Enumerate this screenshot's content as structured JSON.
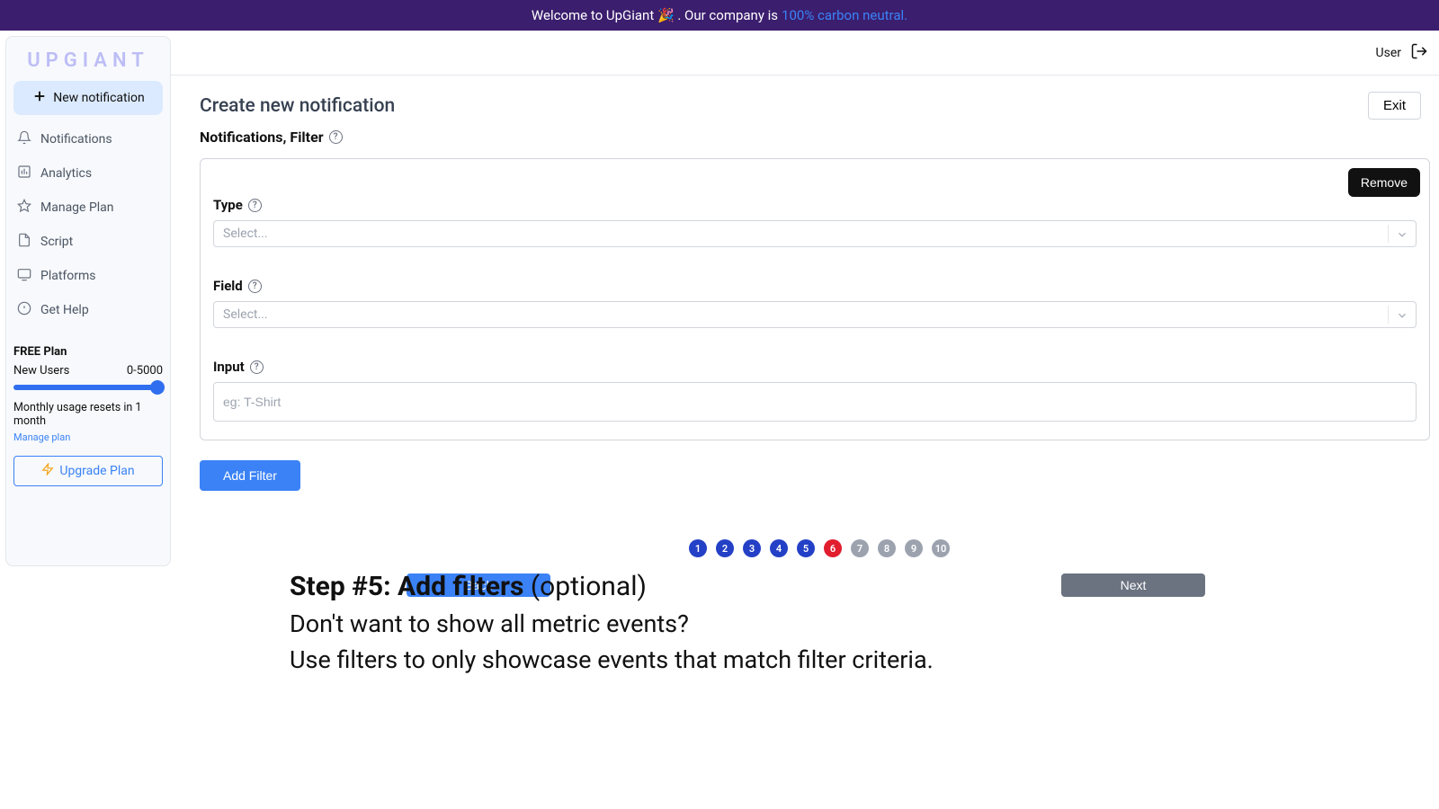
{
  "banner": {
    "text_left": "Welcome to UpGiant 🎉 . Our company is ",
    "link": "100% carbon neutral."
  },
  "brand": "UPGIANT",
  "new_notification_label": "New notification",
  "nav": [
    {
      "label": "Notifications"
    },
    {
      "label": "Analytics"
    },
    {
      "label": "Manage Plan"
    },
    {
      "label": "Script"
    },
    {
      "label": "Platforms"
    },
    {
      "label": "Get Help"
    }
  ],
  "plan": {
    "title": "FREE Plan",
    "row_label": "New Users",
    "row_value": "0-5000",
    "reset": "Monthly usage resets in 1 month",
    "manage_link": "Manage plan",
    "upgrade": "Upgrade Plan"
  },
  "topbar": {
    "user": "User"
  },
  "page": {
    "title": "Create new notification",
    "exit": "Exit",
    "subtitle": "Notifications, Filter"
  },
  "filter": {
    "remove": "Remove",
    "type_label": "Type",
    "field_label": "Field",
    "input_label": "Input",
    "select_placeholder": "Select...",
    "input_placeholder": "eg: T-Shirt"
  },
  "add_filter": "Add Filter",
  "steps": [
    "1",
    "2",
    "3",
    "4",
    "5",
    "6",
    "7",
    "8",
    "9",
    "10"
  ],
  "current_step_index": 5,
  "buttons": {
    "back": "Back",
    "next": "Next"
  },
  "caption": {
    "heading_bold": "Step #5: Add filters",
    "heading_rest": " (optional)",
    "line1": "Don't want to show all metric events?",
    "line2": "Use filters to only showcase events that match filter criteria."
  }
}
